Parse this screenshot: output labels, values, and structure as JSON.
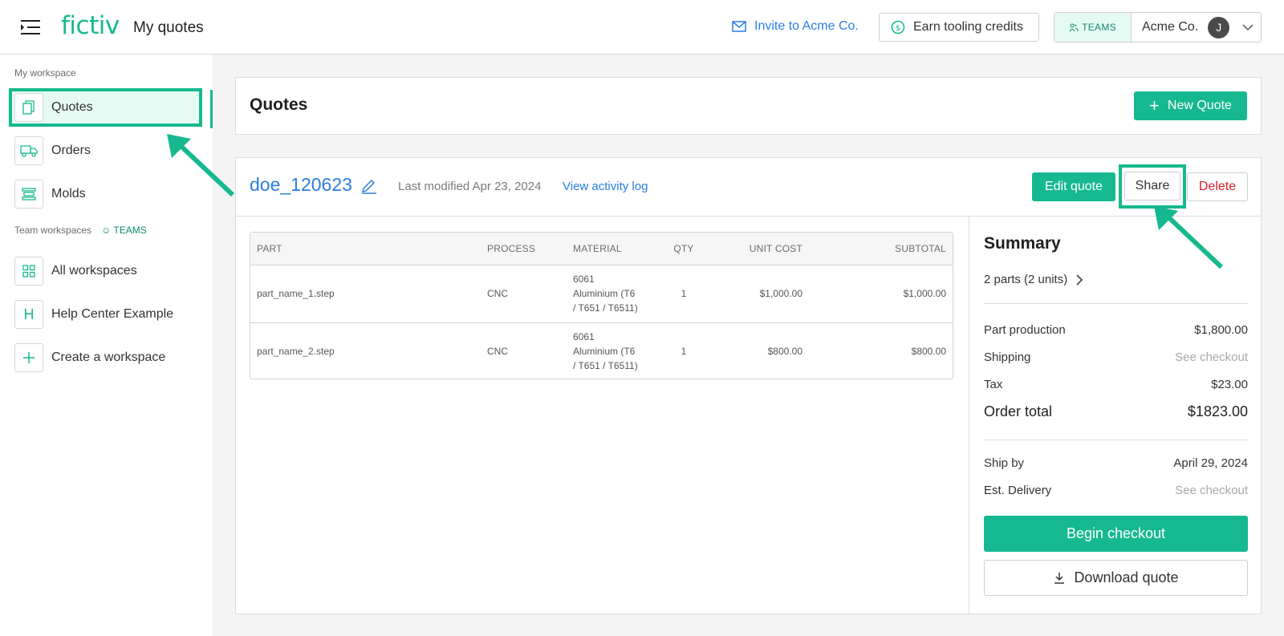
{
  "topbar": {
    "brand": "fictiv",
    "page_title": "My quotes",
    "invite_label": "Invite to Acme Co.",
    "earn_label": "Earn tooling credits",
    "teams_badge": "TEAMS",
    "org_name": "Acme Co.",
    "avatar_initial": "J"
  },
  "sidebar": {
    "my_workspace_label": "My workspace",
    "my_items": [
      {
        "label": "Quotes",
        "icon": "document-copy-icon"
      },
      {
        "label": "Orders",
        "icon": "truck-icon"
      },
      {
        "label": "Molds",
        "icon": "mold-icon"
      }
    ],
    "team_workspaces_label": "Team workspaces",
    "teams_tag": "TEAMS",
    "team_items": [
      {
        "label": "All workspaces",
        "icon": "grid-icon"
      },
      {
        "label": "Help Center Example",
        "icon": "H"
      },
      {
        "label": "Create a workspace",
        "icon": "plus-icon"
      }
    ]
  },
  "main": {
    "title": "Quotes",
    "new_quote_label": "New Quote",
    "quote": {
      "name": "doe_120623",
      "modified": "Last modified Apr 23, 2024",
      "activity_link": "View activity log",
      "edit_label": "Edit quote",
      "share_label": "Share",
      "delete_label": "Delete"
    },
    "table": {
      "headers": [
        "PART",
        "PROCESS",
        "MATERIAL",
        "QTY",
        "UNIT COST",
        "SUBTOTAL"
      ],
      "rows": [
        {
          "part": "part_name_1.step",
          "process": "CNC",
          "material": [
            "6061",
            "Aluminium (T6",
            "/ T651 / T6511)"
          ],
          "qty": "1",
          "unit": "$1,000.00",
          "subtotal": "$1,000.00"
        },
        {
          "part": "part_name_2.step",
          "process": "CNC",
          "material": [
            "6061",
            "Aluminium (T6",
            "/ T651 / T6511)"
          ],
          "qty": "1",
          "unit": "$800.00",
          "subtotal": "$800.00"
        }
      ]
    },
    "summary": {
      "title": "Summary",
      "parts": "2 parts (2 units)",
      "part_production_label": "Part production",
      "part_production": "$1,800.00",
      "shipping_label": "Shipping",
      "shipping": "See checkout",
      "tax_label": "Tax",
      "tax": "$23.00",
      "total_label": "Order total",
      "total": "$1823.00",
      "ship_by_label": "Ship by",
      "ship_by": "April 29, 2024",
      "delivery_label": "Est. Delivery",
      "delivery": "See checkout",
      "checkout_label": "Begin checkout",
      "download_label": "Download quote"
    }
  },
  "colors": {
    "accent": "#16b98f",
    "link": "#2a7de1",
    "danger": "#d0202e"
  }
}
